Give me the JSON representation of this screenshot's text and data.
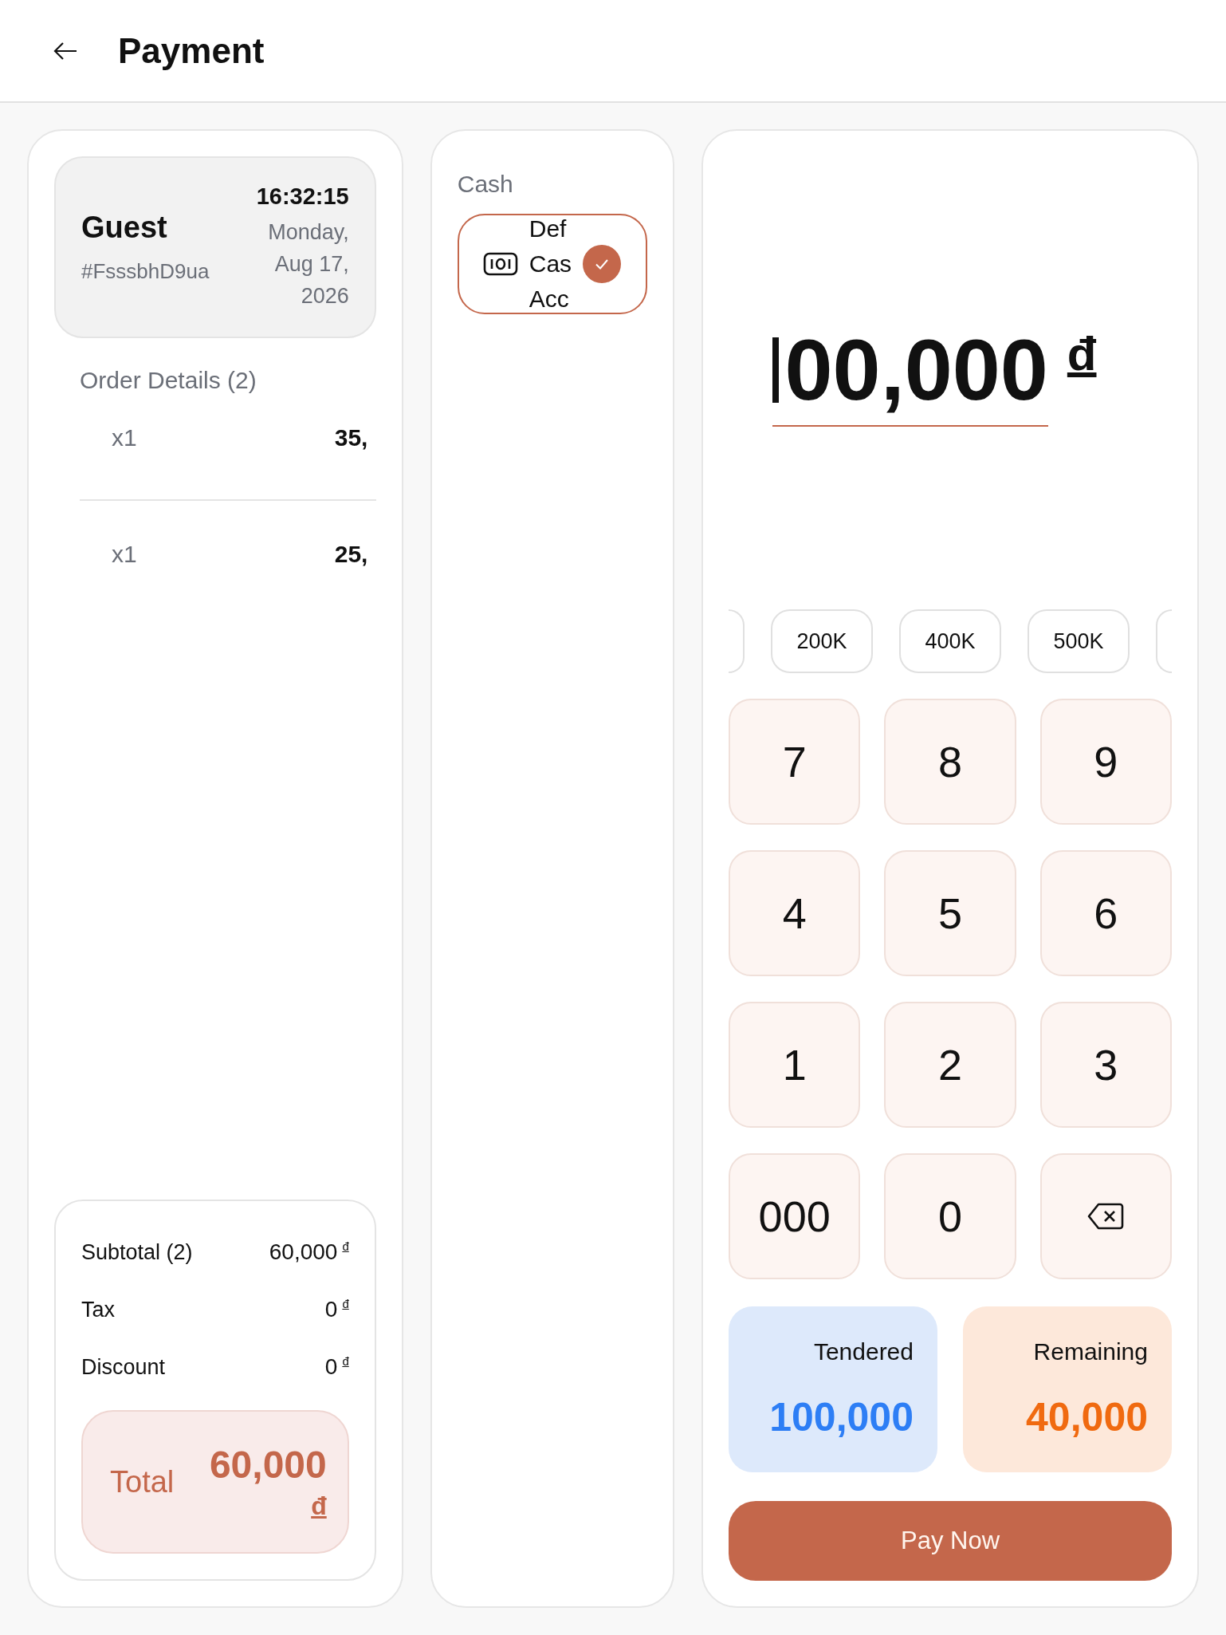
{
  "header": {
    "title": "Payment"
  },
  "customer": {
    "name": "Guest",
    "order_code": "#FsssbhD9ua",
    "time": "16:32:15",
    "date": "Monday, Aug 17, 2026"
  },
  "order_details": {
    "title": "Order Details (2)",
    "items": [
      {
        "quantity": "x1",
        "price": "35,"
      },
      {
        "quantity": "x1",
        "price": "25,"
      }
    ]
  },
  "summary": {
    "rows": [
      {
        "label": "Subtotal (2)",
        "value": "60,000",
        "currency": "đ"
      },
      {
        "label": "Tax",
        "value": "0",
        "currency": "đ"
      },
      {
        "label": "Discount",
        "value": "0",
        "currency": "đ"
      }
    ],
    "total": {
      "label": "Total",
      "value": "60,000",
      "currency": "đ"
    }
  },
  "payment_methods": {
    "group": "Cash",
    "methods": [
      {
        "name_lines": [
          "Def",
          "Cas",
          "Acc"
        ],
        "selected": true
      }
    ]
  },
  "amount_input": {
    "value": "00,000",
    "currency": "đ"
  },
  "quick_amounts": [
    {
      "label": "200K"
    },
    {
      "label": "400K"
    },
    {
      "label": "500K"
    }
  ],
  "keypad": [
    {
      "kind": "digit",
      "label": "7"
    },
    {
      "kind": "digit",
      "label": "8"
    },
    {
      "kind": "digit",
      "label": "9"
    },
    {
      "kind": "digit",
      "label": "4"
    },
    {
      "kind": "digit",
      "label": "5"
    },
    {
      "kind": "digit",
      "label": "6"
    },
    {
      "kind": "digit",
      "label": "1"
    },
    {
      "kind": "digit",
      "label": "2"
    },
    {
      "kind": "digit",
      "label": "3"
    },
    {
      "kind": "digit",
      "label": "000"
    },
    {
      "kind": "digit",
      "label": "0"
    },
    {
      "kind": "backspace"
    }
  ],
  "tendered": {
    "label": "Tendered",
    "value": "100,000"
  },
  "remaining": {
    "label": "Remaining",
    "value": "40,000"
  },
  "pay_button": {
    "label": "Pay Now"
  }
}
